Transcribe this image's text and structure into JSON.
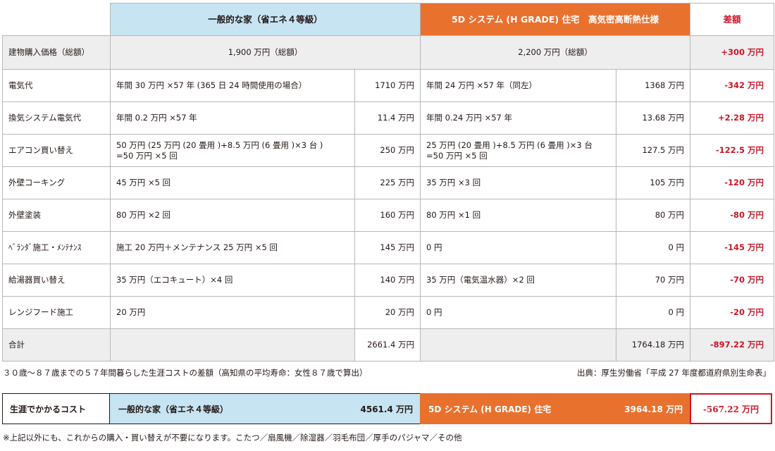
{
  "headers": {
    "normal": "一般的な家（省エネ４等級）",
    "system5d": "5D システム (H GRADE) 住宅　高気密高断熱仕様",
    "diff": "差額"
  },
  "price_row": {
    "label": "建物購入価格（総額）",
    "normal": "1,900 万円（総額）",
    "system5d": "2,200 万円（総額）",
    "diff": "+300 万円"
  },
  "rows": [
    {
      "label": "電気代",
      "normal_desc": "年間 30 万円 ×57 年 (365 日 24 時間使用の場合）",
      "normal_value": "1710 万円",
      "system5d_desc": "年間 24 万円 ×57 年（同左）",
      "system5d_value": "1368 万円",
      "diff": "-342 万円"
    },
    {
      "label": "換気システム電気代",
      "normal_desc": "年間 0.2 万円 ×57 年",
      "normal_value": "11.4 万円",
      "system5d_desc": "年間 0.24 万円 ×57 年",
      "system5d_value": "13.68 万円",
      "diff": "+2.28 万円"
    },
    {
      "label": "エアコン買い替え",
      "normal_desc": "50 万円 (25 万円 (20 畳用 )+8.5 万円 (6 畳用 )×3 台 )\n=50 万円 ×5 回",
      "normal_value": "250 万円",
      "system5d_desc": "25 万円 (20 畳用 )+8.5 万円 (6 畳用 )×3 台\n=50 万円 ×5 回",
      "system5d_value": "127.5 万円",
      "diff": "-122.5 万円"
    },
    {
      "label": "外壁コーキング",
      "normal_desc": "45 万円 ×5 回",
      "normal_value": "225 万円",
      "system5d_desc": "35 万円 ×3 回",
      "system5d_value": "105 万円",
      "diff": "-120 万円"
    },
    {
      "label": "外壁塗装",
      "normal_desc": "80 万円 ×2 回",
      "normal_value": "160 万円",
      "system5d_desc": "80 万円 ×1 回",
      "system5d_value": "80 万円",
      "diff": "-80 万円"
    },
    {
      "label": "ﾍﾞﾗﾝﾀﾞ施工・ﾒﾝﾃﾅﾝｽ",
      "normal_desc": "施工 20 万円＋メンテナンス 25 万円 ×5 回",
      "normal_value": "145 万円",
      "system5d_desc": "0 円",
      "system5d_value": "0 円",
      "diff": "-145 万円"
    },
    {
      "label": "給湯器買い替え",
      "normal_desc": "35 万円（エコキュート）×4 回",
      "normal_value": "140 万円",
      "system5d_desc": "35 万円（電気温水器）×2 回",
      "system5d_value": "70 万円",
      "diff": "-70 万円"
    },
    {
      "label": "レンジフード施工",
      "normal_desc": "20 万円",
      "normal_value": "20 万円",
      "system5d_desc": "0 円",
      "system5d_value": "0 円",
      "diff": "-20 万円"
    }
  ],
  "total_row": {
    "label": "合計",
    "normal_value": "2661.4 万円",
    "system5d_value": "1764.18 万円",
    "diff": "-897.22 万円"
  },
  "note_lifetime": "３０歳～８７歳までの５７年間暮らした生涯コストの差額（高知県の平均寿命：女性８７歳で算出）",
  "source": "出典：厚生労働省「平成 27 年度都道府県別生命表」",
  "summary": {
    "label": "生涯でかかるコスト",
    "normal_name": "一般的な家（省エネ４等級）",
    "normal_value": "4561.4 万円",
    "system5d_name": "5D システム (H GRADE) 住宅",
    "system5d_value": "3964.18 万円",
    "diff": "-567.22 万円"
  },
  "footnote": "※上記以外にも、これからの購入・買い替えが不要になります。こたつ／扇風機／除湿器／羽毛布団／厚手のパジャマ／その他",
  "colors": {
    "normal_bg": "#c7e4f2",
    "system5d_bg": "#e8712e",
    "diff_red": "#c9182a",
    "gray_bg": "#eeeeee"
  }
}
